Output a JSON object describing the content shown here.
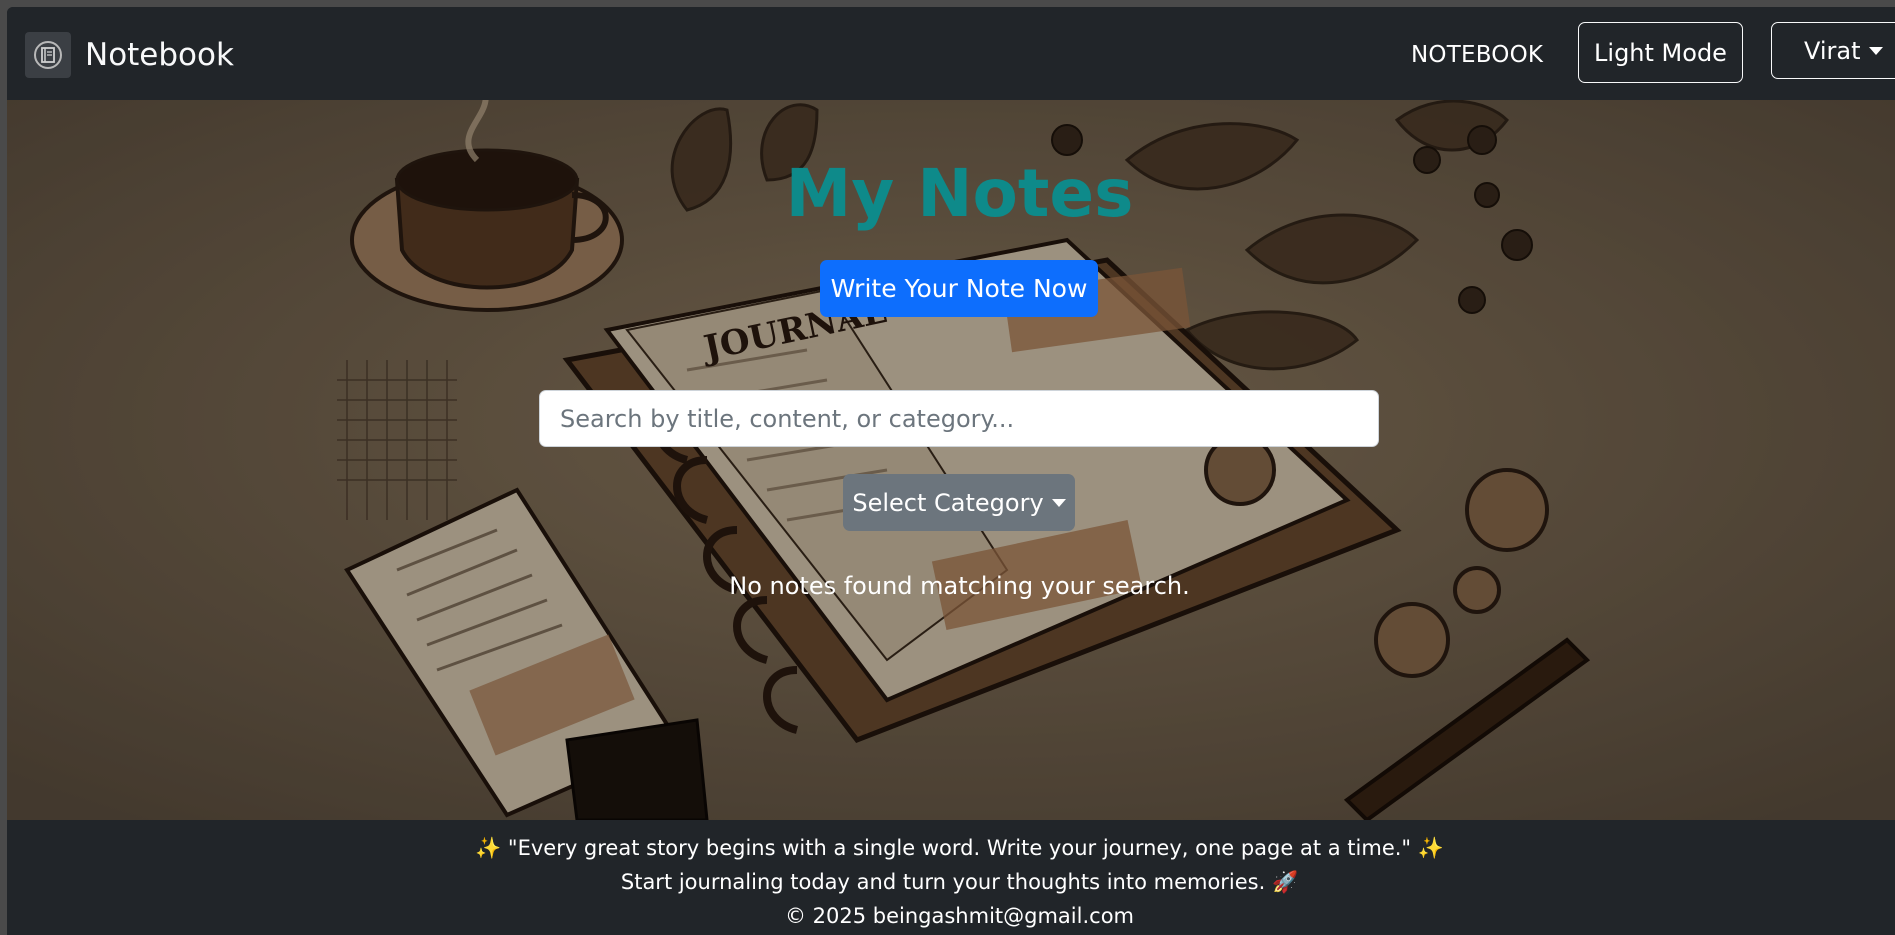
{
  "navbar": {
    "brand_title": "Notebook",
    "logo_icon": "notebook-logo-icon",
    "nav_link": "NOTEBOOK",
    "theme_toggle_label": "Light Mode",
    "user_menu_label": "Virat"
  },
  "hero": {
    "title": "My Notes",
    "write_button_label": "Write Your Note Now",
    "search_placeholder": "Search by title, content, or category...",
    "search_value": "",
    "category_button_label": "Select Category",
    "empty_message": "No notes found matching your search."
  },
  "footer": {
    "quote": "✨ \"Every great story begins with a single word. Write your journey, one page at a time.\" ✨",
    "tagline": "Start journaling today and turn your thoughts into memories. 🚀",
    "copyright": "© 2025 beingashmit@gmail.com"
  },
  "colors": {
    "title": "#0e8a8a",
    "primary_button": "#0d6efd",
    "secondary_button": "#6c757d",
    "navbar_bg": "#212529"
  }
}
